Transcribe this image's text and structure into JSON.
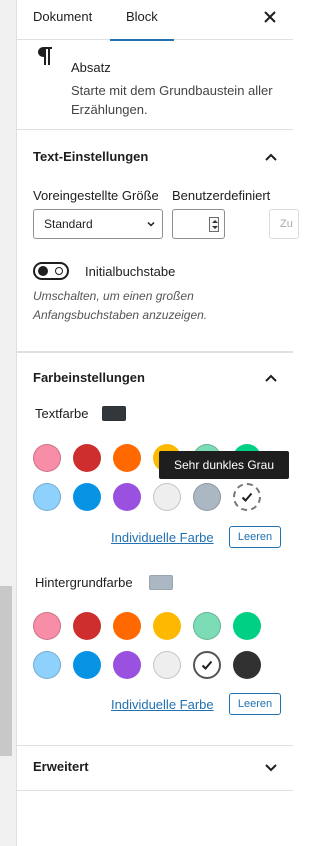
{
  "tabs": [
    {
      "label": "Dokument"
    },
    {
      "label": "Block"
    }
  ],
  "block_card": {
    "title": "Absatz",
    "description": "Starte mit dem Grundbaustein aller Erzählungen."
  },
  "typography": {
    "title": "Text-Einstellungen",
    "preset_label": "Voreingestellte Größe",
    "custom_label": "Benutzerdefiniert",
    "preset_value": "Standard",
    "reset_label": "Zu",
    "dropcap_label": "Initialbuchstabe",
    "dropcap_help": "Umschalten, um einen großen Anfangsbuchstaben anzuzeigen."
  },
  "colors": {
    "title": "Farbeinstellungen",
    "text": {
      "label": "Textfarbe",
      "indicator": "#32373c",
      "custom_link": "Individuelle Farbe",
      "clear_label": "Leeren",
      "tooltip": "Sehr dunkles Grau"
    },
    "background": {
      "label": "Hintergrundfarbe",
      "indicator": "#abb8c3",
      "custom_link": "Individuelle Farbe",
      "clear_label": "Leeren"
    },
    "palette": [
      "#f78da7",
      "#cf2e2e",
      "#ff6900",
      "#fcb900",
      "#7bdcb5",
      "#00d084",
      "#8ed1fc",
      "#0693e3",
      "#9b51e0",
      "#eeeeee",
      "#abb8c3",
      "#313131"
    ]
  },
  "advanced": {
    "title": "Erweitert"
  }
}
